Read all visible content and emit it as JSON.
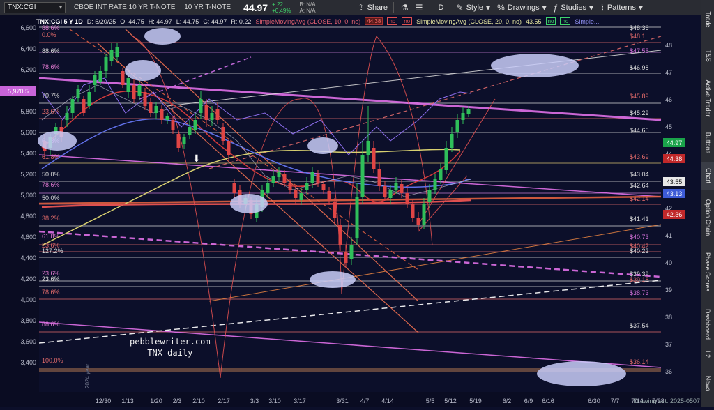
{
  "toolbar": {
    "symbol": "TNX:CGI",
    "description": "CBOE INT RATE 10 YR T-NOTE",
    "description_short": "10 YR T-NOTE",
    "last_price": "44.97",
    "change_abs": "+.22",
    "change_pct": "+0.49%",
    "bid": "B: N/A",
    "ask": "A: N/A",
    "buttons": {
      "share": "Share",
      "period": "D",
      "style": "Style",
      "drawings": "Drawings",
      "studies": "Studies",
      "patterns": "Patterns"
    }
  },
  "study_header": {
    "symbol_period": "TNX:CGI 5 Y 1D",
    "date": "D: 5/20/25",
    "open": "O: 44.75",
    "high": "H: 44.97",
    "low": "L: 44.75",
    "close": "C: 44.97",
    "range": "R: 0.22",
    "sma10": "SimpleMovingAvg (CLOSE, 10, 0, no)",
    "sma10_value": "44.38",
    "chip_no_a": "no",
    "chip_no_b": "no",
    "sma20": "SimpleMovingAvg (CLOSE, 20, 0, no)",
    "sma20_value": "43.55",
    "chip_no_c": "no",
    "chip_no_d": "no",
    "sma_more": "Simple..."
  },
  "left_axis": {
    "ticks": [
      "6,600",
      "6,400",
      "6,200",
      "6,000",
      "5,800",
      "5,600",
      "5,400",
      "5,200",
      "5,000",
      "4,800",
      "4,600",
      "4,400",
      "4,200",
      "4,000",
      "3,800",
      "3,600",
      "3,400"
    ],
    "marker": "5,970.5"
  },
  "right_axis": {
    "ticks": [
      "48",
      "47",
      "46",
      "45",
      "44",
      "43",
      "42",
      "41",
      "40",
      "39",
      "38",
      "37",
      "36"
    ],
    "price_labels": [
      {
        "text": "44.97",
        "color": "#1aa34a"
      },
      {
        "text": "44.38",
        "color": "#c0282a"
      },
      {
        "text": "43.55",
        "color": "#e8e8e8"
      },
      {
        "text": "43.13",
        "color": "#3d5bd6"
      },
      {
        "text": "42.36",
        "color": "#c0282a"
      }
    ]
  },
  "x_axis": {
    "ticks": [
      "12/30",
      "1/13",
      "1/20",
      "2/3",
      "2/10",
      "2/17",
      "3/3",
      "3/10",
      "3/17",
      "3/31",
      "4/7",
      "4/14",
      "5/5",
      "5/12",
      "5/19",
      "6/2",
      "6/9",
      "6/16",
      "6/30",
      "7/7",
      "7/14",
      "7/28"
    ],
    "year_label": "2024 year"
  },
  "fib_left_labels": [
    "88.6%",
    "0.0%",
    "88.6%",
    "78.6%",
    "70.7%",
    "23.6%",
    "61.8%",
    "61.8%",
    "50.0%",
    "78.6%",
    "50.0%",
    "38.2%",
    "61.8%",
    "23.6%",
    "127.2%",
    "23.6%",
    "23.6%",
    "78.6%",
    "88.6%",
    "100.0%"
  ],
  "level_labels": [
    "$48.36",
    "$48.1",
    "$47.55",
    "$46.98",
    "$45.89",
    "$45.29",
    "$44.66",
    "$43.69",
    "$43.04",
    "$42.64",
    "$42.14",
    "$41.41",
    "$40.73",
    "$40.42",
    "$40.22",
    "$39.39",
    "$39.18",
    "$38.73",
    "$37.54",
    "$36.14"
  ],
  "watermark": {
    "line1": "pebblewriter.com",
    "line2": "TNX daily"
  },
  "drawing_set": "Drawing set: 2025-0507",
  "dock_tabs": [
    "Trade",
    "T&S",
    "Active Trader",
    "Buttons",
    "Chart",
    "Option Chain",
    "Phase Scores",
    "Dashboard",
    "L2",
    "News"
  ],
  "colors": {
    "up": "#2fbf5a",
    "down": "#e04545",
    "sma10": "#d23a3a",
    "sma20": "#d8d070",
    "fib_line": "#c98ab2",
    "accent_blue": "#3d5bd6"
  }
}
